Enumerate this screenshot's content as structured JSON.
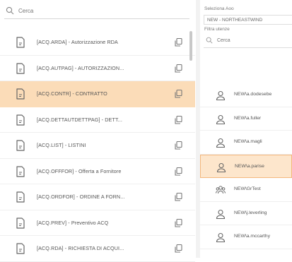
{
  "left": {
    "search": {
      "placeholder": "Cerca"
    },
    "items": [
      {
        "label": "[ACQ.ARDA] - Autorizzazione RDA",
        "selected": false
      },
      {
        "label": "[ACQ.AUTPAG] - AUTORIZZAZION...",
        "selected": false
      },
      {
        "label": "[ACQ.CONTR] - CONTRATTO",
        "selected": true
      },
      {
        "label": "[ACQ.DETTAUTDETTPAG] - DETT...",
        "selected": false
      },
      {
        "label": "[ACQ.LIST] - LISTINI",
        "selected": false
      },
      {
        "label": "[ACQ.OFFFOR] - Offerta a Fornitore",
        "selected": false
      },
      {
        "label": "[ACQ.ORDFOR] - ORDINE A FORN...",
        "selected": false
      },
      {
        "label": "[ACQ.PREV] - Preventivo ACQ",
        "selected": false
      },
      {
        "label": "[ACQ.RDA] - RICHIESTA DI ACQUI...",
        "selected": false
      }
    ]
  },
  "right": {
    "aoo_label": "Seleziona Aoo",
    "aoo_value": "NEW - NORTHEASTWIND",
    "filter_label": "Filtra utenze",
    "search": {
      "placeholder": "Cerca"
    },
    "users": [
      {
        "label": "NEW\\a.dodesebe",
        "type": "user",
        "selected": false
      },
      {
        "label": "NEW\\a.fuller",
        "type": "user",
        "selected": false
      },
      {
        "label": "NEW\\a.magli",
        "type": "user",
        "selected": false
      },
      {
        "label": "NEW\\a.parise",
        "type": "user",
        "selected": true
      },
      {
        "label": "NEW\\GrTest",
        "type": "group",
        "selected": false
      },
      {
        "label": "NEW\\j.leverling",
        "type": "user",
        "selected": false
      },
      {
        "label": "NEW\\a.mccarthy",
        "type": "user",
        "selected": false
      }
    ]
  }
}
